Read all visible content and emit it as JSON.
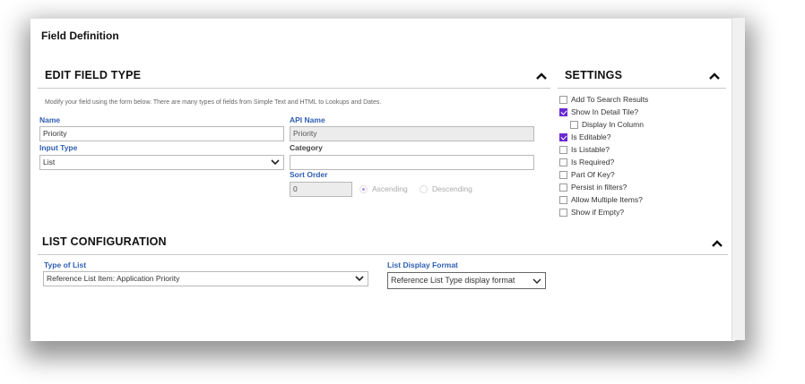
{
  "panel_title": "Field Definition",
  "edit_section": {
    "title": "EDIT FIELD TYPE",
    "description": "Modify your field using the form below. There are many types of fields from Simple Text and HTML to Lookups and Dates.",
    "name_label": "Name",
    "name_value": "Priority",
    "input_type_label": "Input Type",
    "input_type_value": "List",
    "api_name_label": "API Name",
    "api_name_value": "Priority",
    "category_label": "Category",
    "category_value": "",
    "sort_order_label": "Sort Order",
    "sort_order_value": "0",
    "ascending_label": "Ascending",
    "descending_label": "Descending",
    "sort_direction": "Ascending"
  },
  "settings": {
    "title": "SETTINGS",
    "items": [
      {
        "label": "Add To Search Results",
        "checked": false
      },
      {
        "label": "Show In Detail Tile?",
        "checked": true
      },
      {
        "label": "Display In Column",
        "checked": false
      },
      {
        "label": "Is Editable?",
        "checked": true
      },
      {
        "label": "Is Listable?",
        "checked": false
      },
      {
        "label": "Is Required?",
        "checked": false
      },
      {
        "label": "Part Of Key?",
        "checked": false
      },
      {
        "label": "Persist in filters?",
        "checked": false
      },
      {
        "label": "Allow Multiple Items?",
        "checked": false
      },
      {
        "label": "Show if Empty?",
        "checked": false
      }
    ]
  },
  "list_config": {
    "title": "LIST CONFIGURATION",
    "type_label": "Type of List",
    "type_value": "Reference List Item: Application Priority",
    "display_format_label": "List Display Format",
    "display_format_value": "Reference List Type display format"
  },
  "colors": {
    "accent_label": "#2f5fb3",
    "checkbox_checked": "#6a2ad3"
  }
}
